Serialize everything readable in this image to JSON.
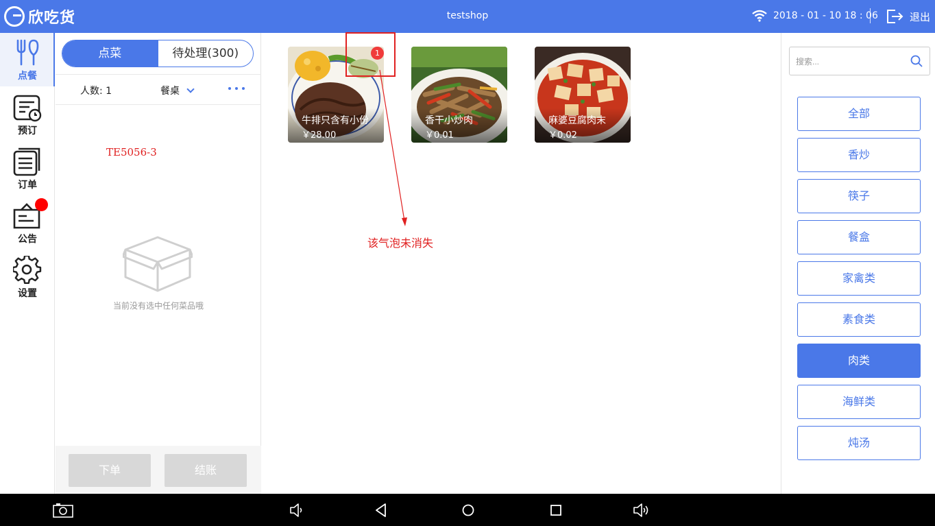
{
  "header": {
    "app_name": "欣吃货",
    "shop_name": "testshop",
    "datetime": "2018 - 01 - 10  18 : 06",
    "logout_label": "退出"
  },
  "nav": {
    "items": [
      {
        "label": "点餐",
        "icon": "cutlery-icon",
        "active": true
      },
      {
        "label": "预订",
        "icon": "reservation-icon",
        "active": false
      },
      {
        "label": "订单",
        "icon": "orders-icon",
        "active": false
      },
      {
        "label": "公告",
        "icon": "announcement-icon",
        "active": false
      },
      {
        "label": "设置",
        "icon": "gear-icon",
        "active": false
      }
    ]
  },
  "order_panel": {
    "tabs": [
      "点菜",
      "待处理(300)"
    ],
    "active_tab": 0,
    "people_label": "人数: 1",
    "table_label": "餐桌",
    "empty_text": "当前没有选中任何菜品哦",
    "submit_label": "下单",
    "checkout_label": "结账"
  },
  "annotations": {
    "table_id": "TE5056-3",
    "note": "该气泡未消失"
  },
  "menu": {
    "badge_count": "1",
    "dishes": [
      {
        "name": "牛排只含有小份",
        "price": "￥28.00"
      },
      {
        "name": "香干小炒肉",
        "price": "￥0.01"
      },
      {
        "name": "麻婆豆腐肉末",
        "price": "￥0.02"
      }
    ]
  },
  "search": {
    "placeholder": "搜索..."
  },
  "categories": {
    "items": [
      "全部",
      "香炒",
      "筷子",
      "餐盒",
      "家禽类",
      "素食类",
      "肉类",
      "海鲜类",
      "炖汤"
    ],
    "active_index": 6
  },
  "colors": {
    "accent": "#4a78e8",
    "alert": "#f03b3b",
    "annotation": "#e02020"
  }
}
